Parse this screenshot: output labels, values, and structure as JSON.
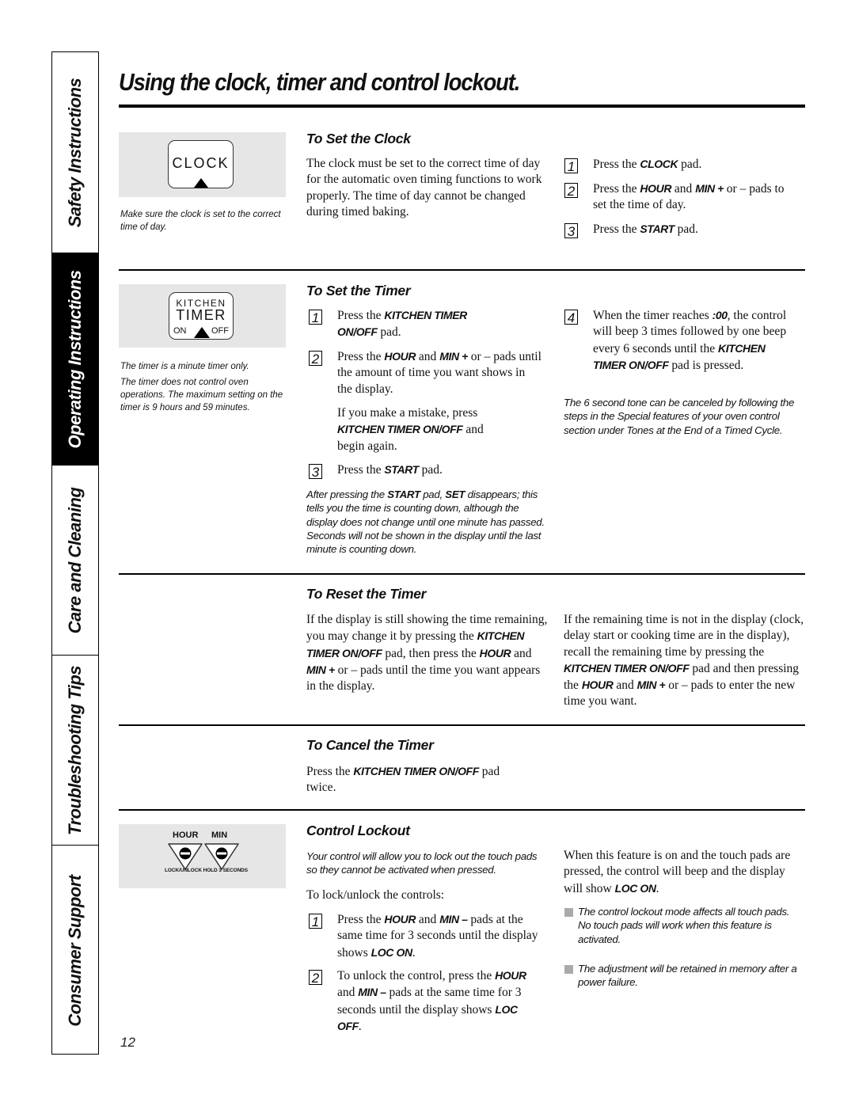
{
  "side_tabs": [
    {
      "label": "Safety Instructions",
      "active": false
    },
    {
      "label": "Operating Instructions",
      "active": true
    },
    {
      "label": "Care and Cleaning",
      "active": false
    },
    {
      "label": "Troubleshooting Tips",
      "active": false
    },
    {
      "label": "Consumer Support",
      "active": false
    }
  ],
  "page_title": "Using the clock, timer and control lockout.",
  "page_number": "12",
  "illustrations": {
    "clock_pad": {
      "label": "CLOCK",
      "caption": "Make sure the clock is set to the correct time of day."
    },
    "timer_pad": {
      "line1": "KITCHEN",
      "line2": "TIMER",
      "on": "ON",
      "off": "OFF",
      "caption1": "The timer is a minute timer only.",
      "caption2": "The timer does not control oven operations. The maximum setting on the timer is 9 hours and 59 minutes."
    },
    "lock_pads": {
      "hour": "HOUR",
      "min": "MIN",
      "note": "LOCK/UNLOCK HOLD 3 SECONDS"
    }
  },
  "set_clock": {
    "heading": "To Set the Clock",
    "body": "The clock must be set to the correct time of day for the automatic oven timing functions to work properly. The time of day cannot be changed during timed baking.",
    "steps": [
      {
        "num": "1",
        "pre": "Press the ",
        "key": "CLOCK",
        "post": " pad."
      },
      {
        "num": "2",
        "pre": "Press the ",
        "key": "HOUR",
        "mid": " and ",
        "key2": "MIN +",
        "post": " or – pads to set the time of day."
      },
      {
        "num": "3",
        "pre": "Press the ",
        "key": "START",
        "post": " pad."
      }
    ]
  },
  "set_timer": {
    "heading": "To Set the Timer",
    "step1": {
      "num": "1",
      "pre": "Press the ",
      "key": "KITCHEN TIMER ON/OFF",
      "post": " pad."
    },
    "step2": {
      "num": "2",
      "pre": "Press the ",
      "key": "HOUR",
      "mid": " and ",
      "key2": "MIN +",
      "post": " or – pads until the amount of time you want shows in the display."
    },
    "mistake": {
      "pre": "If you make a mistake, press ",
      "key": "KITCHEN TIMER ON/OFF",
      "post": " and begin again."
    },
    "step3": {
      "num": "3",
      "pre": "Press the ",
      "key": "START",
      "post": " pad."
    },
    "note": {
      "pre": "After pressing the ",
      "key": "START",
      "mid": " pad, ",
      "key2": "SET",
      "post": " disappears; this tells you the time is counting down, although the display does not change until one minute has passed. Seconds will not be shown in the display until the last minute is counting down."
    },
    "step4": {
      "num": "4",
      "pre": "When the timer reaches ",
      "key": ":00",
      "mid": ", the control will beep 3 times followed by one beep every 6 seconds until the ",
      "key2": "KITCHEN TIMER ON/OFF",
      "post": " pad is pressed."
    },
    "tone_note": "The 6 second tone can be canceled by following the steps in the Special features of your oven control section under Tones at the End of a Timed Cycle."
  },
  "reset_timer": {
    "heading": "To Reset the Timer",
    "left": {
      "p1": "If the display is still showing the time remaining, you may change it by pressing the ",
      "k1": "KITCHEN TIMER ON/OFF",
      "p2": " pad, then press the ",
      "k2": "HOUR",
      "p3": " and ",
      "k3": "MIN +",
      "p4": " or – pads until the time you want appears in the display."
    },
    "right": {
      "p1": "If the remaining time is not in the display (clock, delay start or cooking time are in the display), recall the remaining time by pressing the ",
      "k1": "KITCHEN TIMER ON/OFF",
      "p2": " pad and then pressing the ",
      "k2": "HOUR",
      "p3": " and ",
      "k3": "MIN +",
      "p4": " or – pads to enter the new time you want."
    }
  },
  "cancel_timer": {
    "heading": "To Cancel the Timer",
    "pre": "Press the ",
    "key": "KITCHEN TIMER ON/OFF",
    "post": " pad twice."
  },
  "control_lockout": {
    "heading": "Control Lockout",
    "intro": "Your control will allow you to lock out the touch pads so they cannot be activated when pressed.",
    "lead": "To lock/unlock the controls:",
    "step1": {
      "num": "1",
      "pre": "Press the ",
      "key": "HOUR",
      "mid": " and ",
      "key2": "MIN –",
      "mid2": " pads at the same time for 3 seconds until the display shows ",
      "key3": "LOC ON",
      "post": "."
    },
    "step2": {
      "num": "2",
      "pre": "To unlock the control, press the ",
      "key": "HOUR",
      "mid": " and ",
      "key2": "MIN –",
      "mid2": " pads at the same time for 3 seconds until the display shows ",
      "key3": "LOC OFF",
      "post": "."
    },
    "right": {
      "pre": "When this feature is on and the touch pads are pressed, the control will beep and the display will show ",
      "key": "LOC ON",
      "post": "."
    },
    "bullets": [
      "The control lockout mode affects all touch pads. No touch pads will work when this feature is activated.",
      "The adjustment will be retained in memory after a power failure."
    ]
  }
}
